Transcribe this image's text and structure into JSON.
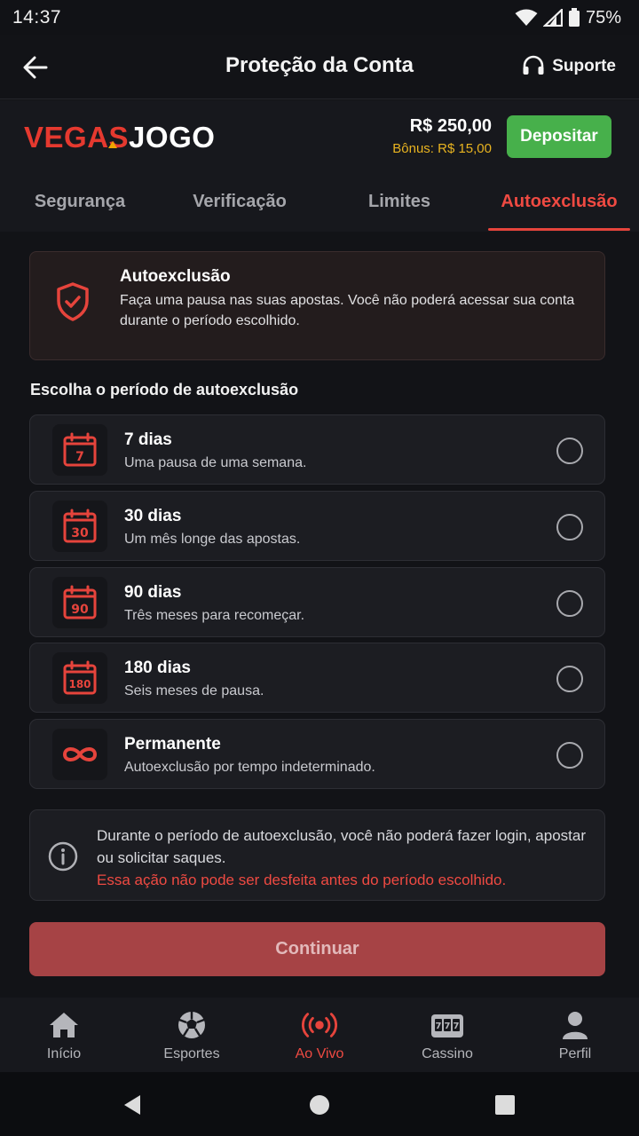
{
  "status_bar": {
    "time": "14:37",
    "battery": "75%"
  },
  "header": {
    "title": "Proteção da Conta",
    "support_label": "Suporte"
  },
  "brand": {
    "logo_part1": "VEGAS",
    "logo_part2": "JOGO",
    "balance": "R$ 250,00",
    "bonus": "Bônus: R$ 15,00",
    "deposit_label": "Depositar"
  },
  "tabs": [
    {
      "label": "Segurança"
    },
    {
      "label": "Verificação"
    },
    {
      "label": "Limites"
    },
    {
      "label": "Autoexclusão"
    }
  ],
  "active_tab": "Autoexclusão",
  "warning": {
    "title": "Autoexclusão",
    "text": "Faça uma pausa nas suas apostas. Você não poderá acessar sua conta durante o período escolhido."
  },
  "section_label": "Escolha o período de autoexclusão",
  "options": [
    {
      "title": "7 dias",
      "subtitle": "Uma pausa de uma semana.",
      "icon_number": "7",
      "icon": "calendar-icon",
      "selected": false
    },
    {
      "title": "30 dias",
      "subtitle": "Um mês longe das apostas.",
      "icon_number": "30",
      "icon": "calendar-icon",
      "selected": false
    },
    {
      "title": "90 dias",
      "subtitle": "Três meses para recomeçar.",
      "icon_number": "90",
      "icon": "calendar-icon",
      "selected": false
    },
    {
      "title": "180 dias",
      "subtitle": "Seis meses de pausa.",
      "icon_number": "180",
      "icon": "calendar-icon",
      "selected": false
    },
    {
      "title": "Permanente",
      "subtitle": "Autoexclusão por tempo indeterminado.",
      "icon": "infinity-icon",
      "selected": false
    }
  ],
  "info": {
    "text": "Durante o período de autoexclusão, você não poderá fazer login, apostar ou solicitar saques.",
    "warning": "Essa ação não pode ser desfeita antes do período escolhido."
  },
  "continue_label": "Continuar",
  "bottom_nav": [
    {
      "label": "Início",
      "icon": "home-icon"
    },
    {
      "label": "Esportes",
      "icon": "soccer-ball-icon"
    },
    {
      "label": "Ao Vivo",
      "icon": "live-broadcast-icon"
    },
    {
      "label": "Cassino",
      "icon": "slot-machine-icon"
    },
    {
      "label": "Perfil",
      "icon": "user-icon"
    }
  ],
  "active_nav": "Ao Vivo",
  "colors": {
    "accent": "#e6443c",
    "deposit": "#47b04b",
    "bonus": "#e8b320",
    "background": "#121317"
  }
}
